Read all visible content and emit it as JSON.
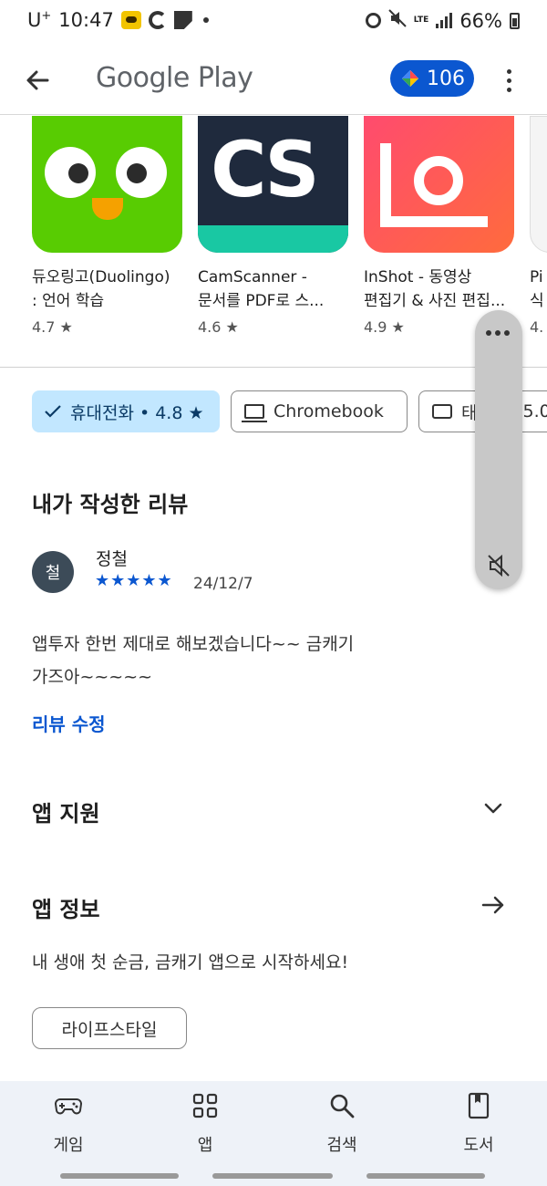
{
  "status_bar": {
    "carrier": "U",
    "carrier_sup": "+",
    "time": "10:47",
    "network": "LTE",
    "battery": "66%"
  },
  "app_bar": {
    "title": "Google Play",
    "points": "106"
  },
  "apps": [
    {
      "name_line1": "듀오링고(Duolingo)",
      "name_line2": ": 언어 학습",
      "rating": "4.7 ★"
    },
    {
      "name_line1": "CamScanner -",
      "name_line2": "문서를 PDF로 스...",
      "rating": "4.6 ★"
    },
    {
      "name_line1": "InShot - 동영상",
      "name_line2": "편집기 & 사진 편집...",
      "rating": "4.9 ★"
    },
    {
      "name_line1": "Pi",
      "name_line2": "식",
      "rating": "4."
    }
  ],
  "icons": {
    "app1_text": "",
    "app2_text": "CS"
  },
  "chips": {
    "phone": "휴대전화 • 4.8 ★",
    "chromebook": "Chromebook",
    "tablet": "태",
    "tablet_rating": "5.0"
  },
  "review": {
    "section_title": "내가 작성한 리뷰",
    "avatar_initial": "철",
    "reviewer": "정철",
    "stars": "★★★★★",
    "date": "24/12/7",
    "text_line1": "앱투자 한번 제대로 해보겠습니다~~ 금캐기",
    "text_line2": "가즈아~~~~~",
    "edit_label": "리뷰 수정"
  },
  "support": {
    "title": "앱 지원"
  },
  "about": {
    "title": "앱 정보",
    "text": "내 생애 첫 순금, 금캐기 앱으로 시작하세요!",
    "tag": "라이프스타일"
  },
  "bottom_nav": [
    {
      "label": "게임",
      "icon": "gamepad-icon"
    },
    {
      "label": "앱",
      "icon": "apps-grid-icon"
    },
    {
      "label": "검색",
      "icon": "search-icon"
    },
    {
      "label": "도서",
      "icon": "book-icon"
    }
  ],
  "colors": {
    "accent": "#0b57d0",
    "chip_selected": "#c2e7ff",
    "nav_bg": "#eef2f8"
  }
}
